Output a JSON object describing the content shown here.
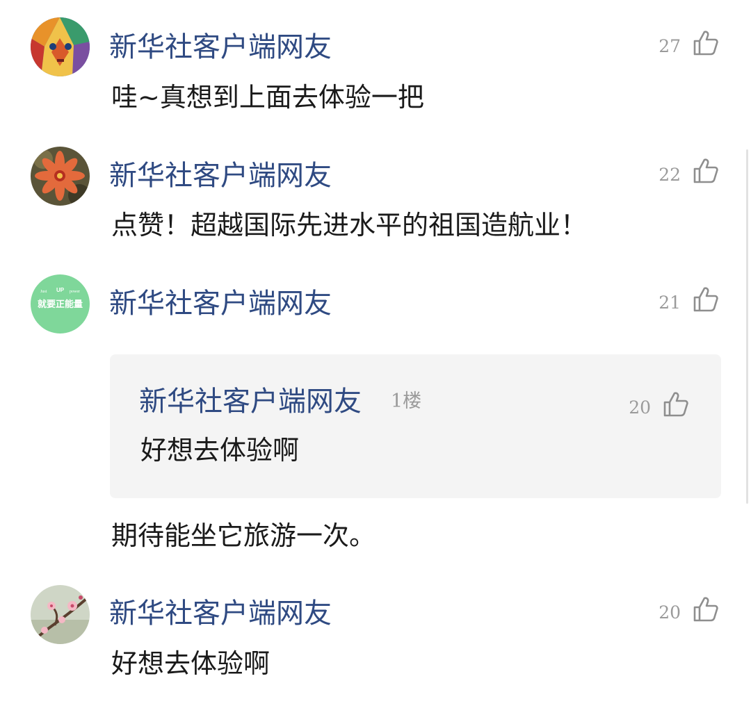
{
  "comments": [
    {
      "username": "新华社客户端网友",
      "text": "哇~真想到上面去体验一把",
      "likes": "27",
      "avatar": "colorful-mask-avatar"
    },
    {
      "username": "新华社客户端网友",
      "text": "点赞！超越国际先进水平的祖国造航业！",
      "likes": "22",
      "avatar": "flower-avatar"
    },
    {
      "username": "新华社客户端网友",
      "likes": "21",
      "avatar": "positive-energy-avatar",
      "avatar_text": {
        "top_left": "Just",
        "top_mid": "UP",
        "top_right": "power",
        "main": "就要正能量"
      },
      "reply": {
        "username": "新华社客户端网友",
        "floor": "1楼",
        "text": "好想去体验啊",
        "likes": "20"
      },
      "text": "期待能坐它旅游一次。"
    },
    {
      "username": "新华社客户端网友",
      "text": "好想去体验啊",
      "likes": "20",
      "avatar": "blossom-branch-avatar"
    }
  ],
  "icons": {
    "like": "thumbs-up-icon"
  },
  "colors": {
    "username": "#2f4a82",
    "text": "#1a1a1a",
    "meta": "#9a9a9a",
    "reply_bg": "#f4f4f4",
    "avatar3_bg": "#7fd79a"
  }
}
